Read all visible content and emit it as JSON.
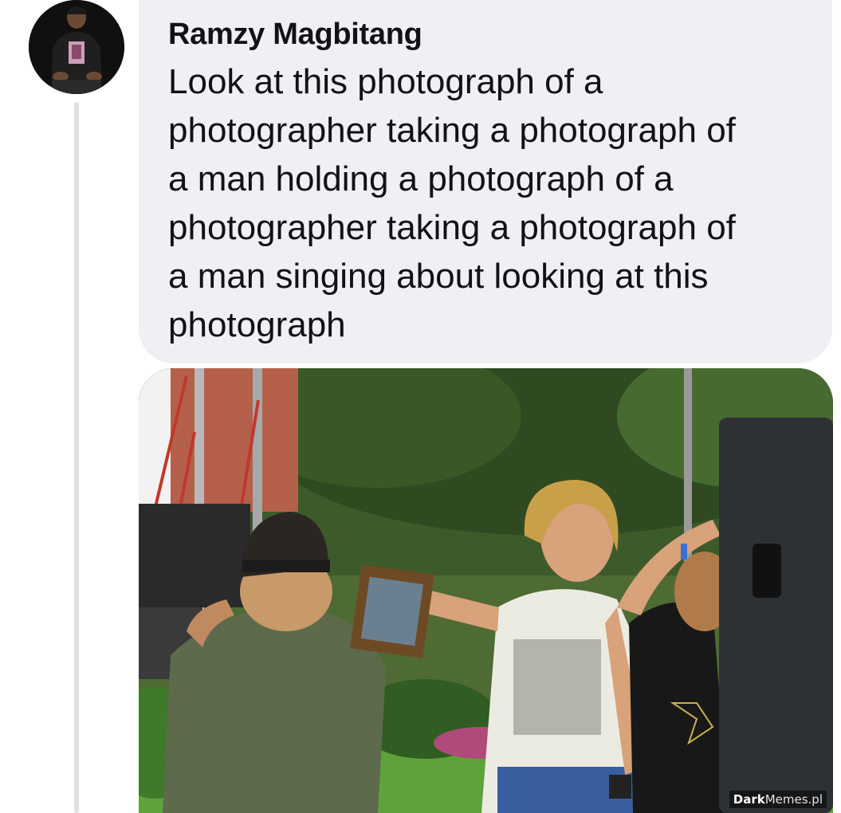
{
  "comment": {
    "author_name": "Ramzy Magbitang",
    "text": "Look at this photograph of a\nphotographer taking a photograph of\na man holding a photograph of a\nphotographer taking a photograph of\na man singing about looking at this\nphotograph"
  },
  "photo": {
    "watermark": {
      "brand": "Dark",
      "rest": "Memes.pl"
    }
  },
  "colors": {
    "bubble_background": "#eff0f4",
    "thread_line": "#dfe1e6",
    "text": "#111217"
  },
  "icons": {
    "avatar": "user-avatar"
  }
}
